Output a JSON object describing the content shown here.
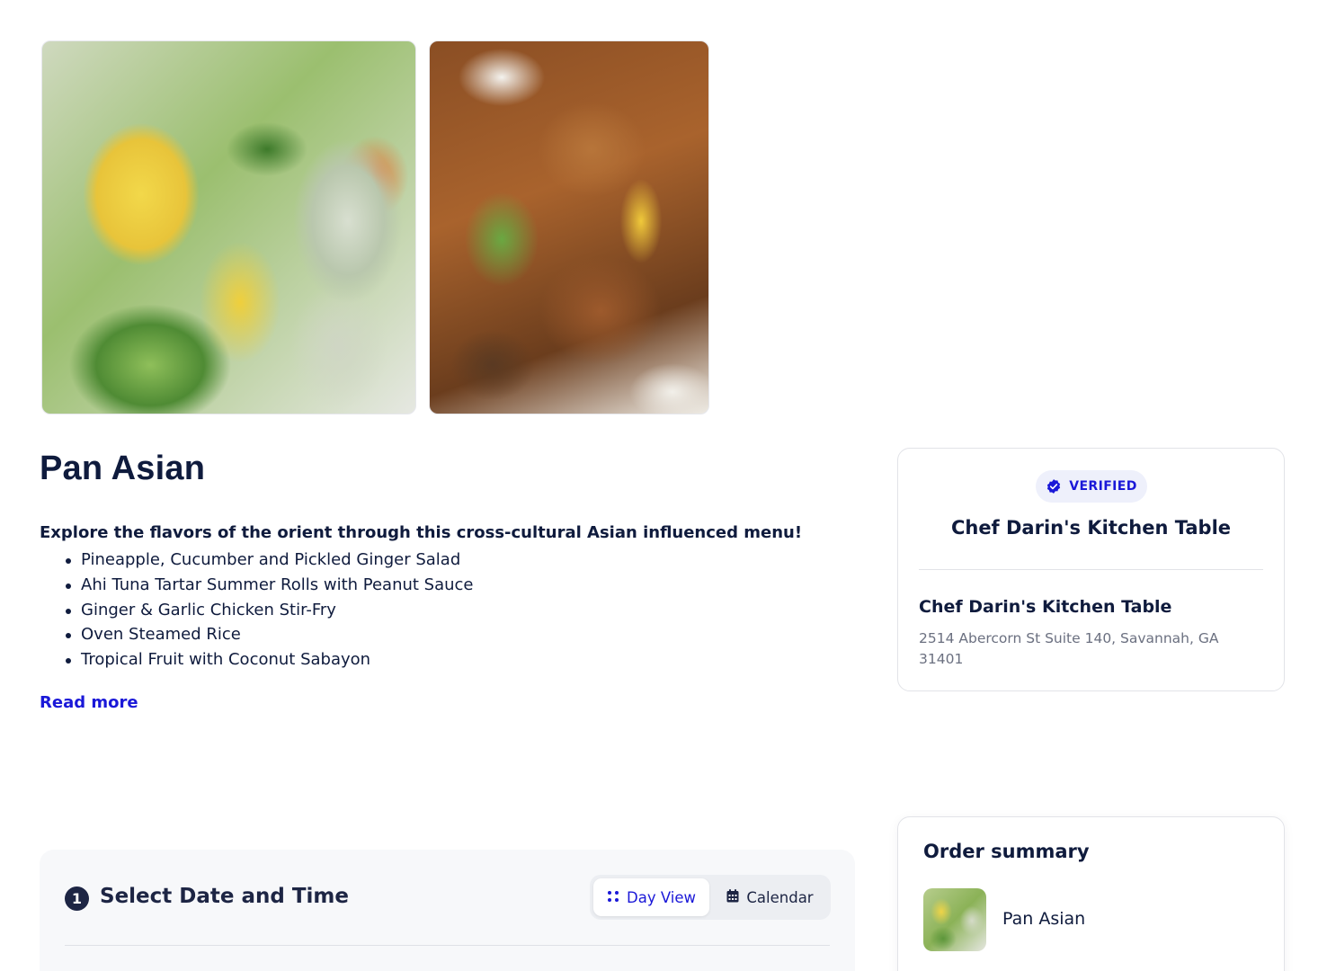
{
  "menu": {
    "title": "Pan Asian",
    "intro": "Explore the flavors of the orient through this cross-cultural Asian influenced menu!",
    "items": [
      "Pineapple, Cucumber and Pickled Ginger Salad",
      "Ahi Tuna Tartar Summer Rolls with Peanut Sauce",
      "Ginger & Garlic Chicken Stir-Fry",
      "Oven Steamed Rice",
      "Tropical Fruit with Coconut Sabayon"
    ],
    "read_more": "Read more"
  },
  "chef_card": {
    "badge": "VERIFIED",
    "name_center": "Chef Darin's Kitchen Table",
    "name": "Chef Darin's Kitchen Table",
    "address": "2514 Abercorn St Suite 140, Savannah, GA 31401"
  },
  "order_summary": {
    "title": "Order summary",
    "item_name": "Pan Asian"
  },
  "booking": {
    "step_number": "1",
    "title": "Select Date and Time",
    "day_view_label": "Day View",
    "calendar_label": "Calendar"
  },
  "colors": {
    "accent": "#1a18d8",
    "text": "#0f1b3d",
    "muted": "#6b7080",
    "badge_bg": "#eef0fb"
  },
  "icons": {
    "verified": "verified-check-icon",
    "day_view": "grid-dots-icon",
    "calendar": "calendar-icon"
  }
}
